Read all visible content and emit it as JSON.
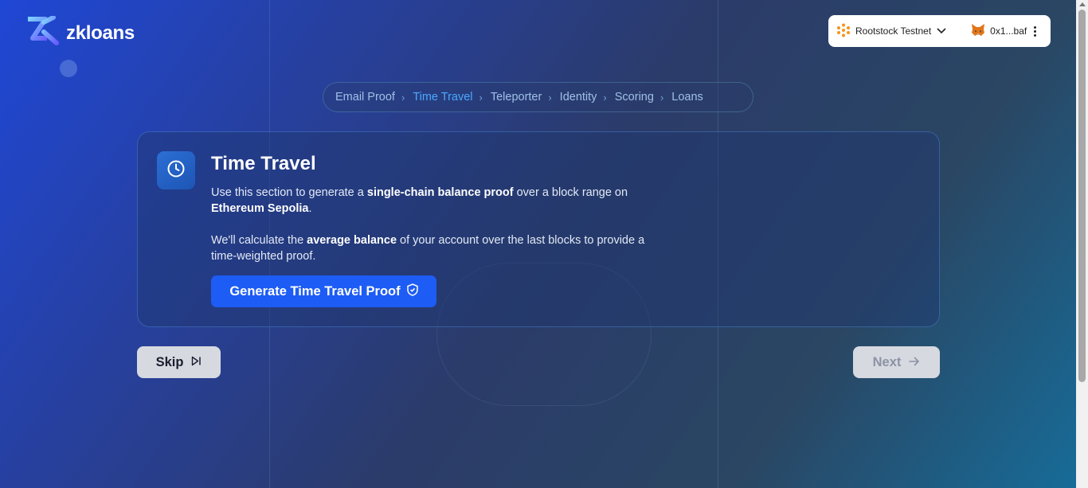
{
  "logo": {
    "text": "zkloans"
  },
  "wallet": {
    "network_label": "Rootstock Testnet",
    "account_label": "0x1...baf"
  },
  "stepper": {
    "steps": [
      "Email Proof",
      "Time Travel",
      "Teleporter",
      "Identity",
      "Scoring",
      "Loans"
    ],
    "active_step": "Time Travel"
  },
  "card": {
    "title": "Time Travel",
    "p1_a": "Use this section to generate a ",
    "p1_b": "single-chain balance proof",
    "p1_c": " over a block range on ",
    "p1_d": "Ethereum Sepolia",
    "p1_e": ".",
    "p2_a": "We'll calculate the ",
    "p2_b": "average balance",
    "p2_c": " of your account over the last blocks to provide a time-weighted proof.",
    "button_label": "Generate Time Travel Proof"
  },
  "nav": {
    "skip_label": "Skip",
    "next_label": "Next"
  },
  "colors": {
    "primary_button": "#1d5cf5",
    "active_step": "#4aa8ff"
  }
}
